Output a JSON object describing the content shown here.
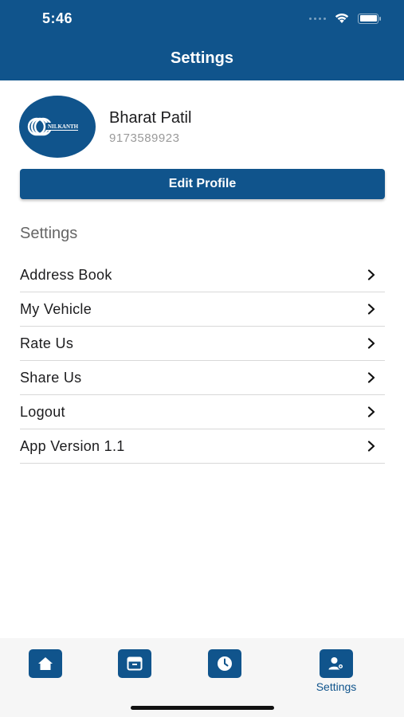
{
  "status": {
    "time": "5:46"
  },
  "header": {
    "title": "Settings"
  },
  "profile": {
    "name": "Bharat Patil",
    "phone": "9173589923",
    "avatar_logo_text": "NILKANTH"
  },
  "edit_profile_label": "Edit Profile",
  "settings_heading": "Settings",
  "menu": [
    {
      "label": "Address Book"
    },
    {
      "label": "My Vehicle"
    },
    {
      "label": "Rate Us"
    },
    {
      "label": "Share Us"
    },
    {
      "label": "Logout"
    },
    {
      "label": "App Version 1.1"
    }
  ],
  "tabs": [
    {
      "icon": "home-icon",
      "label": ""
    },
    {
      "icon": "box-icon",
      "label": ""
    },
    {
      "icon": "clock-icon",
      "label": ""
    },
    {
      "icon": "user-settings-icon",
      "label": "Settings",
      "active": true
    }
  ],
  "colors": {
    "brand": "#10548c",
    "tabbar_bg": "#f6f6f6",
    "divider": "#d8d8d8"
  }
}
